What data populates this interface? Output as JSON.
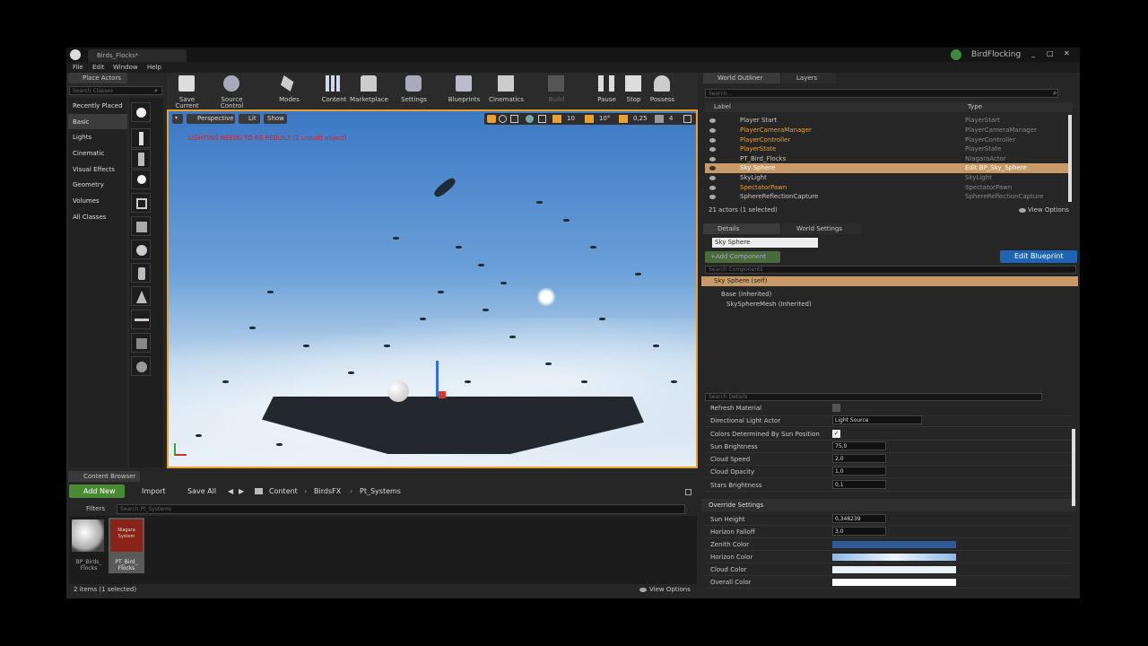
{
  "app": {
    "tab_title": "Birds_Flocks*",
    "project_name": "BirdFlocking",
    "menu": [
      "File",
      "Edit",
      "Window",
      "Help"
    ]
  },
  "place_actors": {
    "tab_title": "Place Actors",
    "search_placeholder": "Search Classes",
    "categories": [
      "Recently Placed",
      "Basic",
      "Lights",
      "Cinematic",
      "Visual Effects",
      "Geometry",
      "Volumes",
      "All Classes"
    ],
    "selected_category": "Basic"
  },
  "toolbar": {
    "buttons": [
      {
        "label": "Save Current",
        "icon": "save-icon"
      },
      {
        "label": "Source Control",
        "icon": "source-control-icon"
      },
      {
        "label": "Modes",
        "icon": "modes-icon"
      },
      {
        "label": "Content",
        "icon": "content-icon"
      },
      {
        "label": "Marketplace",
        "icon": "marketplace-icon"
      },
      {
        "label": "Settings",
        "icon": "settings-icon"
      },
      {
        "label": "Blueprints",
        "icon": "blueprints-icon"
      },
      {
        "label": "Cinematics",
        "icon": "cinematics-icon"
      },
      {
        "label": "Build",
        "icon": "build-icon"
      },
      {
        "label": "Pause",
        "icon": "pause-icon"
      },
      {
        "label": "Stop",
        "icon": "stop-icon"
      },
      {
        "label": "Possess",
        "icon": "possess-icon"
      }
    ]
  },
  "viewport": {
    "view_mode": "Perspective",
    "lighting_mode": "Lit",
    "show_label": "Show",
    "warning": "LIGHTING NEEDS TO BE REBUILT (1 unbuilt object)",
    "grid_snap": "10",
    "rotation_snap": "10°",
    "scale_snap": "0,25",
    "camera_speed": "4"
  },
  "world_outliner": {
    "tabs": [
      "World Outliner",
      "Layers"
    ],
    "search_placeholder": "Search...",
    "columns": [
      "Label",
      "Type"
    ],
    "rows": [
      {
        "label": "Player Start",
        "type": "PlayerStart"
      },
      {
        "label": "PlayerCameraManager",
        "type": "PlayerCameraManager"
      },
      {
        "label": "PlayerController",
        "type": "PlayerController"
      },
      {
        "label": "PlayerState",
        "type": "PlayerState"
      },
      {
        "label": "PT_Bird_Flocks",
        "type": "NiagaraActor"
      },
      {
        "label": "Sky Sphere",
        "type": "Edit BP_Sky_Sphere",
        "selected": true
      },
      {
        "label": "SkyLight",
        "type": "SkyLight"
      },
      {
        "label": "SpectatorPawn",
        "type": "SpectatorPawn"
      },
      {
        "label": "SphereReflectionCapture",
        "type": "SphereReflectionCapture"
      }
    ],
    "status": "21 actors (1 selected)",
    "view_options": "View Options"
  },
  "details": {
    "tabs": [
      "Details",
      "World Settings"
    ],
    "name": "Sky Sphere",
    "add_component": "+Add Component",
    "edit_blueprint": "Edit Blueprint",
    "search_components_placeholder": "Search Components",
    "tree": [
      "Sky Sphere (self)",
      "Base (Inherited)",
      "SkySphereMesh (Inherited)"
    ],
    "search_details_placeholder": "Search Details",
    "properties": [
      {
        "label": "Refresh Material",
        "kind": "checkbox",
        "checked": false
      },
      {
        "label": "Directional Light Actor",
        "kind": "dropdown",
        "value": "Light Source"
      },
      {
        "label": "Colors Determined By Sun Position",
        "kind": "checkbox",
        "checked": true
      },
      {
        "label": "Sun Brightness",
        "kind": "number",
        "value": "75,0"
      },
      {
        "label": "Cloud Speed",
        "kind": "number",
        "value": "2,0"
      },
      {
        "label": "Cloud Opacity",
        "kind": "number",
        "value": "1,0"
      },
      {
        "label": "Stars Brightness",
        "kind": "number",
        "value": "0,1"
      }
    ],
    "override_section": "Override Settings",
    "override_properties": [
      {
        "label": "Sun Height",
        "kind": "number",
        "value": "0,348239"
      },
      {
        "label": "Horizon Falloff",
        "kind": "number",
        "value": "3,0"
      },
      {
        "label": "Zenith Color",
        "kind": "color",
        "color": "#2e5a9c"
      },
      {
        "label": "Horizon Color",
        "kind": "color",
        "color": "#bcd8f2"
      },
      {
        "label": "Cloud Color",
        "kind": "color",
        "color": "#e8f0f8"
      },
      {
        "label": "Overall Color",
        "kind": "color",
        "color": "#ffffff"
      }
    ]
  },
  "content_browser": {
    "tab_title": "Content Browser",
    "add_new": "Add New",
    "import": "Import",
    "save_all": "Save All",
    "path": [
      "Content",
      "BirdsFX",
      "Pt_Systems"
    ],
    "filters": "Filters",
    "search_placeholder": "Search Pt_Systems",
    "assets": [
      {
        "name": "BP_Birds_ Flocks"
      },
      {
        "name": "PT_Bird_ Flocks",
        "thumb_text": "Niagara System",
        "selected": true
      }
    ],
    "status": "2 items (1 selected)",
    "view_options": "View Options"
  },
  "colors": {
    "accent": "#e8a030",
    "selection": "#c89a68",
    "blue_button": "#1e64b4",
    "green_button": "#4a8a32"
  }
}
